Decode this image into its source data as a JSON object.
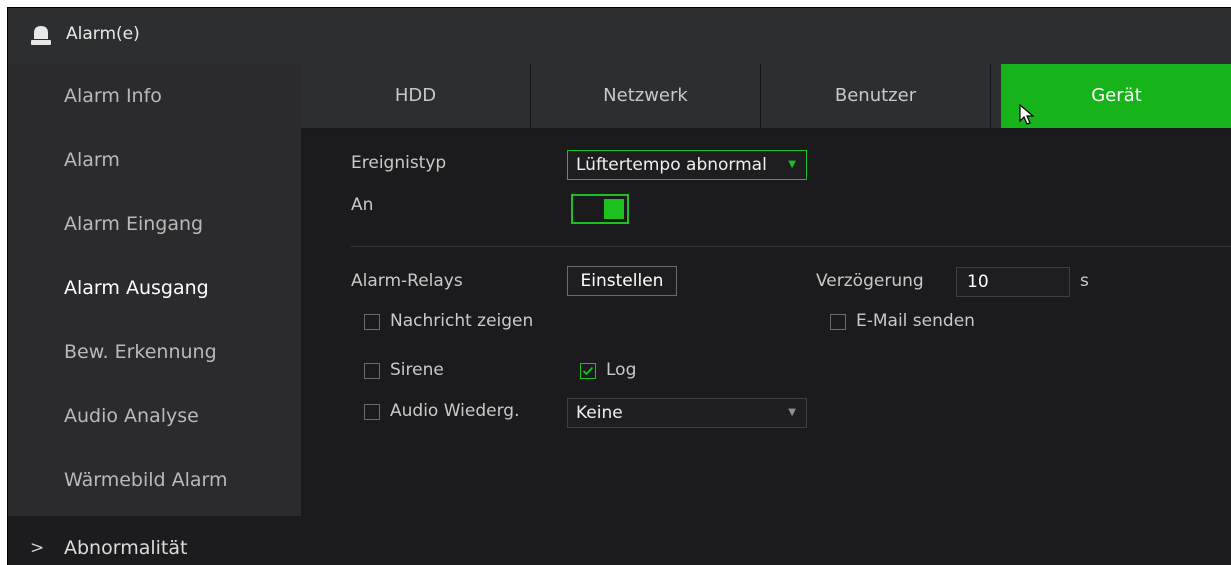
{
  "window": {
    "title": "Alarm(e)",
    "icon": "alarm-bell-icon"
  },
  "sidebar": {
    "items": [
      {
        "label": "Alarm Info"
      },
      {
        "label": "Alarm"
      },
      {
        "label": "Alarm Eingang"
      },
      {
        "label": "Alarm Ausgang",
        "selected": true
      },
      {
        "label": "Bew. Erkennung"
      },
      {
        "label": "Audio Analyse"
      },
      {
        "label": "Wärmebild Alarm"
      },
      {
        "label": "Abnormalität",
        "expanded": true,
        "chevron": ">"
      }
    ]
  },
  "tabs": [
    {
      "label": "HDD"
    },
    {
      "label": "Netzwerk"
    },
    {
      "label": "Benutzer"
    },
    {
      "label": "Gerät",
      "active": true
    }
  ],
  "form": {
    "event_type_label": "Ereignistyp",
    "event_type_value": "Lüftertempo abnormal",
    "enable_label": "An",
    "enable_on": true,
    "alarm_relays_label": "Alarm-Relays",
    "setup_button": "Einstellen",
    "delay_label": "Verzögerung",
    "delay_value": "10",
    "delay_unit": "s",
    "show_message_label": "Nachricht zeigen",
    "show_message_checked": false,
    "send_email_label": "E-Mail senden",
    "send_email_checked": false,
    "buzzer_label": "Sirene",
    "buzzer_checked": false,
    "log_label": "Log",
    "log_checked": true,
    "audio_play_label": "Audio Wiederg.",
    "audio_play_checked": false,
    "audio_file_value": "Keine"
  },
  "colors": {
    "accent": "#16b41a",
    "background": "#1b1b1d",
    "sidebar": "#2b2b2d"
  }
}
